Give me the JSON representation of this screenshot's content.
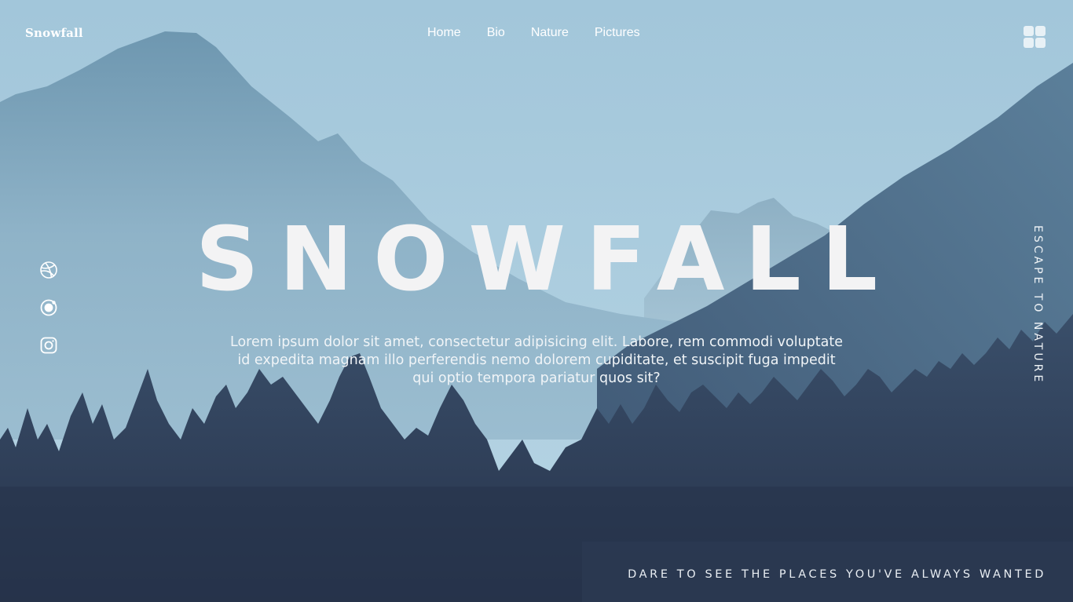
{
  "brand": {
    "logo_text": "Snowfall"
  },
  "nav": {
    "items": [
      "Home",
      "Bio",
      "Nature",
      "Pictures"
    ]
  },
  "hero": {
    "title": "SNOWFALL",
    "description": "Lorem ipsum dolor sit amet, consectetur adipisicing elit. Labore, rem commodi voluptate id expedita magnam illo perferendis nemo dolorem cupiditate, et suscipit fuga impedit qui optio tempora pariatur quos sit?"
  },
  "social_icons": [
    "dribbble-icon",
    "target-icon",
    "instagram-icon"
  ],
  "side_text": "ESCAPE TO NATURE",
  "bottom_banner": "DARE TO SEE THE PLACES YOU'VE ALWAYS WANTED",
  "colors": {
    "sky": "#a9cbdd",
    "mountain": "#7ea6bd",
    "forest_dark": "#2d3a52",
    "text": "#f3f3f4"
  }
}
